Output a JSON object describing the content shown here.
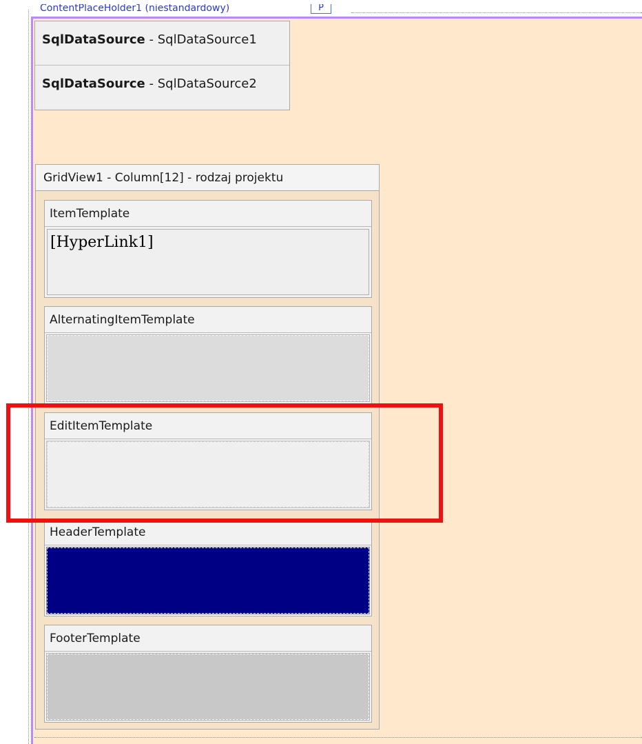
{
  "content_placeholder": {
    "label": "ContentPlaceHolder1 (niestandardowy)",
    "tag": "P"
  },
  "data_sources": [
    {
      "type": "SqlDataSource",
      "separator": " - ",
      "id": "SqlDataSource1"
    },
    {
      "type": "SqlDataSource",
      "separator": " - ",
      "id": "SqlDataSource2"
    }
  ],
  "gridview": {
    "title": "GridView1 - Column[12] - rodzaj projektu",
    "templates": [
      {
        "name": "ItemTemplate",
        "content": "[HyperLink1]"
      },
      {
        "name": "AlternatingItemTemplate",
        "content": ""
      },
      {
        "name": "EditItemTemplate",
        "content": ""
      },
      {
        "name": "HeaderTemplate",
        "content": ""
      },
      {
        "name": "FooterTemplate",
        "content": ""
      }
    ]
  },
  "colors": {
    "placeholder_background": "#ffe8cc",
    "placeholder_border": "#b58cf5",
    "header_template_fill": "#000084",
    "highlight": "#ee1111"
  },
  "highlight": {
    "target": "EditItemTemplate"
  }
}
